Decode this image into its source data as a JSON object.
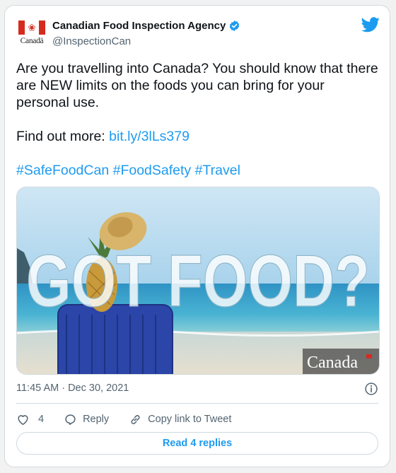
{
  "tweet": {
    "author": {
      "display_name": "Canadian Food Inspection Agency",
      "handle": "@InspectionCan",
      "avatar_wordmark": "Canadä",
      "verified": true
    },
    "text": {
      "line1": "Are you travelling into Canada? You should know that there are NEW limits on the foods you can bring for your personal use.",
      "find_out_label": "Find out more: ",
      "link": "bit.ly/3lLs379",
      "hashtags": [
        "#SafeFoodCan",
        "#FoodSafety",
        "#Travel"
      ]
    },
    "image": {
      "headline": "GOT FOOD?",
      "wordmark": "Canada"
    },
    "timestamp": "11:45 AM · Dec 30, 2021",
    "actions": {
      "like_count": "4",
      "reply_label": "Reply",
      "copy_link_label": "Copy link to Tweet"
    },
    "read_replies_label": "Read 4 replies",
    "colors": {
      "accent": "#1d9bf0",
      "flag_red": "#d52b1e",
      "muted": "#536471"
    },
    "icons": [
      "twitter-bird-icon",
      "verified-badge-icon",
      "info-icon",
      "heart-icon",
      "reply-icon",
      "link-icon"
    ]
  }
}
